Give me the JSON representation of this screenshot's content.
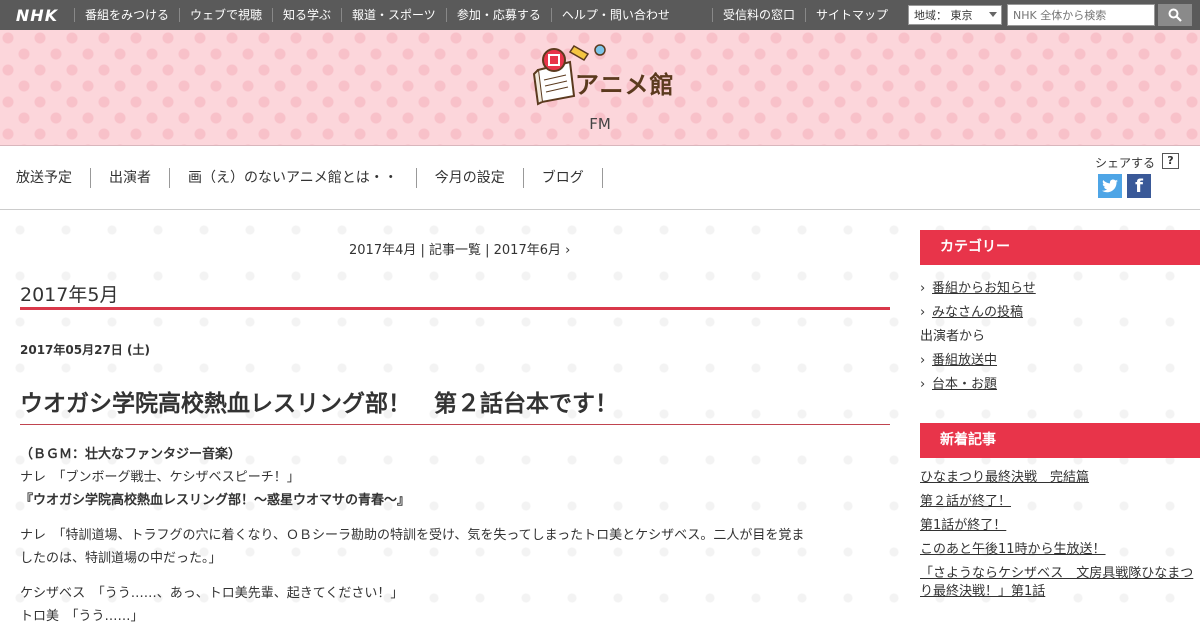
{
  "topbar": {
    "logo": "NHK",
    "nav": [
      "番組をみつける",
      "ウェブで視聴",
      "知る学ぶ",
      "報道・スポーツ",
      "参加・応募する",
      "ヘルプ・問い合わせ"
    ],
    "nav_right": [
      "受信料の窓口",
      "サイトマップ"
    ],
    "region": "地域： 東京",
    "search_placeholder": "NHK 全体から検索"
  },
  "header": {
    "logo_text": "アニメ館",
    "subtitle": "FM"
  },
  "mainnav": {
    "links": [
      "放送予定",
      "出演者",
      "画（え）のないアニメ館とは・・",
      "今月の設定",
      "ブログ"
    ],
    "share_label": "シェアする",
    "help_label": "?"
  },
  "pager": "2017年4月 | 記事一覧 | 2017年6月 ›",
  "archive": {
    "month": "2017年5月"
  },
  "post": {
    "date": "2017年05月27日 (土)",
    "title": "ウオガシ学院高校熱血レスリング部！　第２話台本です！",
    "lines": [
      "（ＢＧＭ：壮大なファンタジー音楽）",
      "ナレ　「ブンボーグ戦士、ケシザベスピーチ！」",
      "『ウオガシ学院高校熱血レスリング部！～惑星ウオマサの青春～』",
      "ナレ　「特訓道場、トラフグの穴に着くなり、ＯＢシーラ勘助の特訓を受け、気を失ってしまったトロ美とケシザベス。二人が目を覚ま",
      "したのは、特訓道場の中だった。」",
      "ケシザベス　「うう……、あっ、トロ美先輩、起きてください！」",
      "トロ美　「うう……」"
    ]
  },
  "sidebar": {
    "categories_title": "カテゴリー",
    "categories": [
      {
        "label": "番組からお知らせ",
        "link": true
      },
      {
        "label": "みなさんの投稿",
        "link": true
      },
      {
        "label": "出演者から",
        "link": false
      },
      {
        "label": "番組放送中",
        "link": true
      },
      {
        "label": "台本・お題",
        "link": true
      }
    ],
    "news_title": "新着記事",
    "news": [
      "ひなまつり最終決戦　完結篇",
      "第２話が終了！",
      "第1話が終了！",
      "このあと午後11時から生放送！",
      "「さようならケシザベス　文房具戦隊ひなまつり最終決戦！」第1話"
    ]
  },
  "colors": {
    "accent": "#e8344a",
    "topbar": "#5a5a5a",
    "header_bg": "#fcd6db"
  }
}
